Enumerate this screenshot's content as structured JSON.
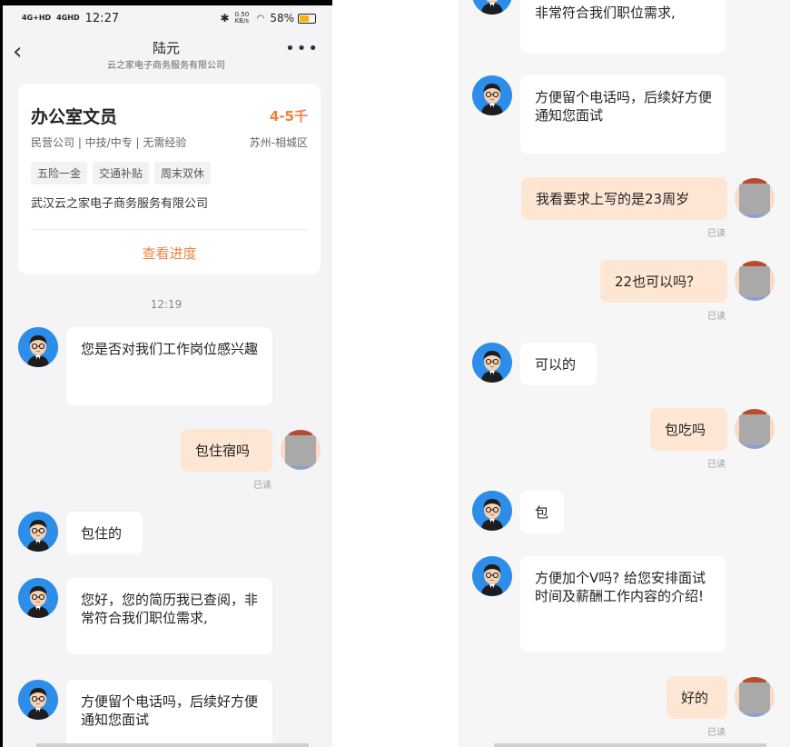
{
  "status": {
    "signal1": "4G+HD",
    "signal2": "4GHD",
    "time": "12:27",
    "net_speed": "0.50 KB/s",
    "battery": "58%"
  },
  "header": {
    "title": "陆元",
    "subtitle": "云之家电子商务服务有限公司"
  },
  "job": {
    "title": "办公室文员",
    "salary": "4-5千",
    "meta": "民营公司 | 中技/中专 | 无需经验",
    "location": "苏州-相城区",
    "tags": [
      "五险一金",
      "交通补贴",
      "周末双休"
    ],
    "company": "武汉云之家电子商务服务有限公司",
    "progress_label": "查看进度"
  },
  "timestamp": "12:19",
  "left_messages": [
    {
      "text": "您是否对我们工作岗位感兴趣"
    },
    {
      "text": "包住宿吗",
      "read": "已读"
    },
    {
      "text": "包住的"
    },
    {
      "text": "您好，您的简历我已查阅，非常符合我们职位需求,"
    },
    {
      "text": "方便留个电话吗，后续好方便通知您面试"
    }
  ],
  "right_messages": [
    {
      "text": "非常符合我们职位需求,"
    },
    {
      "text": "方便留个电话吗，后续好方便通知您面试"
    },
    {
      "text": "我看要求上写的是23周岁",
      "read": "已读"
    },
    {
      "text": "22也可以吗？",
      "read": "已读"
    },
    {
      "text": "可以的"
    },
    {
      "text": "包吃吗",
      "read": "已读"
    },
    {
      "text": "包"
    },
    {
      "text": "方便加个V吗? 给您安排面试时间及薪酬工作内容的介绍!"
    },
    {
      "text": "好的",
      "read": "已读"
    }
  ],
  "icons": {
    "back": "back-arrow-icon",
    "more": "more-icon",
    "wifi": "wifi-icon",
    "bluetooth": "bluetooth-icon",
    "battery": "battery-icon"
  },
  "colors": {
    "accent": "#f0823c",
    "outgoing_bubble": "#fde7d4",
    "incoming_bubble": "#ffffff",
    "avatar_bg": "#2c8ee8",
    "background": "#f4f4f6"
  }
}
